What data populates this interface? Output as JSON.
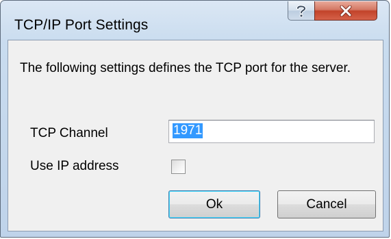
{
  "window": {
    "title": "TCP/IP Port Settings",
    "help_icon": "question-mark-icon",
    "close_icon": "close-x-icon",
    "accent_close": "#c7432b"
  },
  "content": {
    "description": "The following settings defines the TCP port for the server.",
    "tcp_channel_label": "TCP Channel",
    "tcp_channel_value": "1971",
    "use_ip_label": "Use IP address",
    "use_ip_checked": false
  },
  "buttons": {
    "ok_label": "Ok",
    "cancel_label": "Cancel"
  }
}
